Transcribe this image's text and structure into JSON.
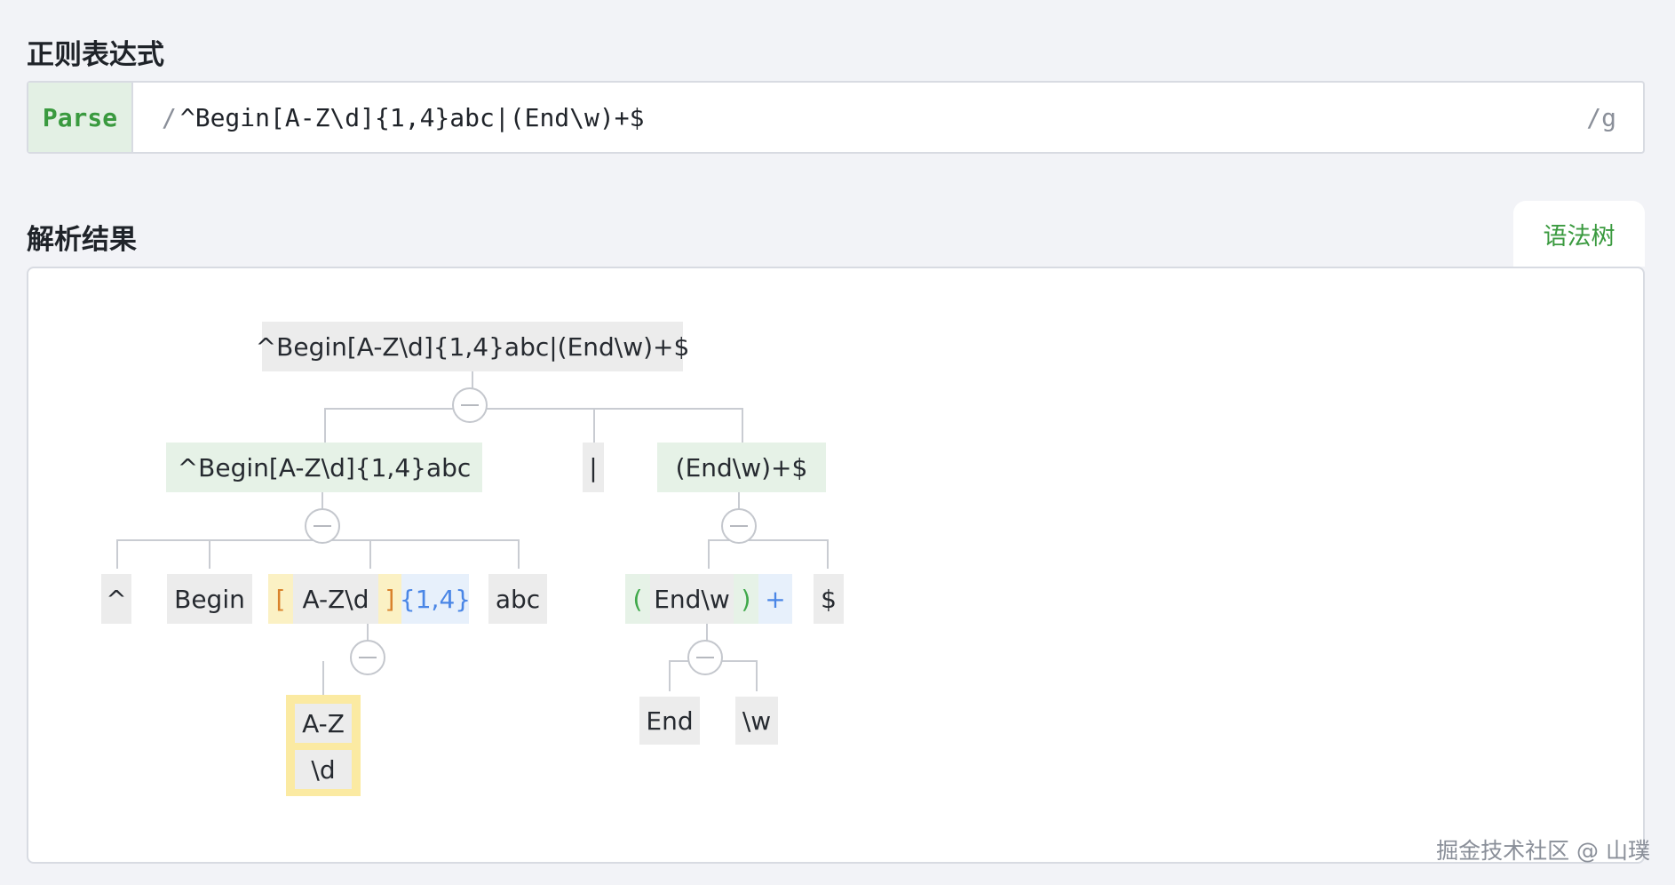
{
  "header": {
    "regex_title": "正则表达式",
    "result_title": "解析结果"
  },
  "input": {
    "parse_label": "Parse",
    "slash_left": "/",
    "value": "^Begin[A-Z\\d]{1,4}abc|(End\\w)+$",
    "flags": "/g"
  },
  "tabs": {
    "syntax_tree": "语法树"
  },
  "tree": {
    "root": "^Begin[A-Z\\d]{1,4}abc|(End\\w)+$",
    "branch_left": "^Begin[A-Z\\d]{1,4}abc",
    "alternation": "|",
    "branch_right": "(End\\w)+$",
    "caret": "^",
    "begin": "Begin",
    "set_open": "[",
    "set_body": "A-Z\\d",
    "set_close": "]",
    "quantifier_1_4": "{1,4}",
    "abc": "abc",
    "group_open": "(",
    "group_body": "End\\w",
    "group_close": ")",
    "plus": "+",
    "dollar": "$",
    "set_item_range": "A-Z",
    "set_item_digit": "\\d",
    "group_item_end": "End",
    "group_item_word": "\\w"
  },
  "watermark": "掘金技术社区 @ 山璞"
}
